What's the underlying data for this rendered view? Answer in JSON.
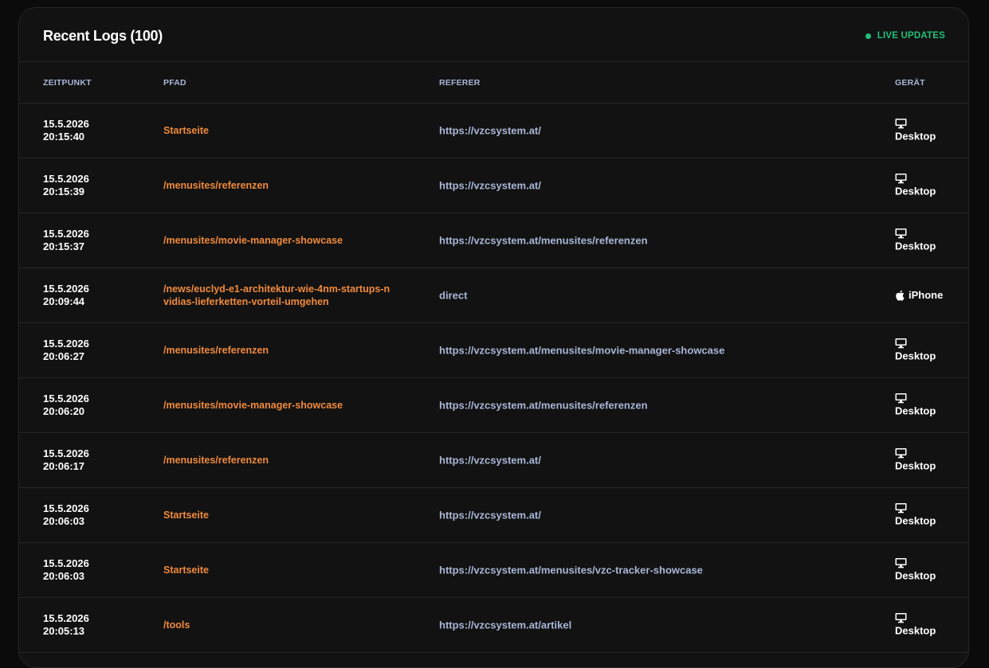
{
  "header": {
    "title": "Recent Logs (100)",
    "live_label": "LIVE UPDATES"
  },
  "columns": {
    "time": "ZEITPUNKT",
    "path": "PFAD",
    "referer": "REFERER",
    "device": "GERÄT"
  },
  "colors": {
    "path": "#f08a3c",
    "referer": "#a9b6d6",
    "live": "#22c07a"
  },
  "rows": [
    {
      "date": "15.5.2026",
      "time": "20:15:40",
      "path": "Startseite",
      "referer": "https://vzcsystem.at/",
      "device": "Desktop",
      "icon": "desktop-icon"
    },
    {
      "date": "15.5.2026",
      "time": "20:15:39",
      "path": "/menusites/referenzen",
      "referer": "https://vzcsystem.at/",
      "device": "Desktop",
      "icon": "desktop-icon"
    },
    {
      "date": "15.5.2026",
      "time": "20:15:37",
      "path": "/menusites/movie-manager-showcase",
      "referer": "https://vzcsystem.at/menusites/referenzen",
      "device": "Desktop",
      "icon": "desktop-icon"
    },
    {
      "date": "15.5.2026",
      "time": "20:09:44",
      "path": "/news/euclyd-e1-architektur-wie-4nm-startups-nvidias-lieferketten-vorteil-umgehen",
      "referer": "direct",
      "device": "iPhone",
      "icon": "apple-icon"
    },
    {
      "date": "15.5.2026",
      "time": "20:06:27",
      "path": "/menusites/referenzen",
      "referer": "https://vzcsystem.at/menusites/movie-manager-showcase",
      "device": "Desktop",
      "icon": "desktop-icon"
    },
    {
      "date": "15.5.2026",
      "time": "20:06:20",
      "path": "/menusites/movie-manager-showcase",
      "referer": "https://vzcsystem.at/menusites/referenzen",
      "device": "Desktop",
      "icon": "desktop-icon"
    },
    {
      "date": "15.5.2026",
      "time": "20:06:17",
      "path": "/menusites/referenzen",
      "referer": "https://vzcsystem.at/",
      "device": "Desktop",
      "icon": "desktop-icon"
    },
    {
      "date": "15.5.2026",
      "time": "20:06:03",
      "path": "Startseite",
      "referer": "https://vzcsystem.at/",
      "device": "Desktop",
      "icon": "desktop-icon"
    },
    {
      "date": "15.5.2026",
      "time": "20:06:03",
      "path": "Startseite",
      "referer": "https://vzcsystem.at/menusites/vzc-tracker-showcase",
      "device": "Desktop",
      "icon": "desktop-icon"
    },
    {
      "date": "15.5.2026",
      "time": "20:05:13",
      "path": "/tools",
      "referer": "https://vzcsystem.at/artikel",
      "device": "Desktop",
      "icon": "desktop-icon"
    }
  ]
}
